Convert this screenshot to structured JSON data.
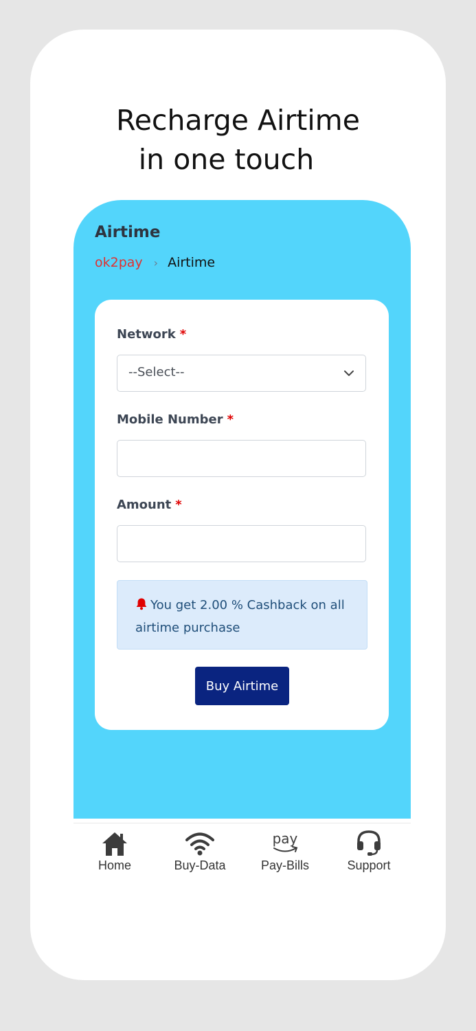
{
  "promo": {
    "line1": "Recharge Airtime",
    "line2": "in one touch"
  },
  "page": {
    "title": "Airtime",
    "breadcrumb_home": "ok2pay",
    "breadcrumb_separator": "›",
    "breadcrumb_current": "Airtime"
  },
  "form": {
    "network_label": "Network",
    "network_selected": "--Select--",
    "mobile_label": "Mobile Number",
    "mobile_value": "",
    "amount_label": "Amount",
    "amount_value": "",
    "required_marker": "*",
    "cashback_text": "You get 2.00 % Cashback on all airtime purchase",
    "buy_label": "Buy Airtime"
  },
  "bottom_nav": {
    "items": [
      {
        "label": "Home",
        "icon": "home-icon"
      },
      {
        "label": "Buy-Data",
        "icon": "wifi-icon"
      },
      {
        "label": "Pay-Bills",
        "icon": "amazon-pay-icon",
        "icon_text": "pay"
      },
      {
        "label": "Support",
        "icon": "headset-icon"
      }
    ]
  },
  "colors": {
    "screen_bg": "#53d5fb",
    "button": "#0a2480",
    "required": "#e00000",
    "breadcrumb_home": "#e03131",
    "alert_bg": "#dcebfb"
  }
}
